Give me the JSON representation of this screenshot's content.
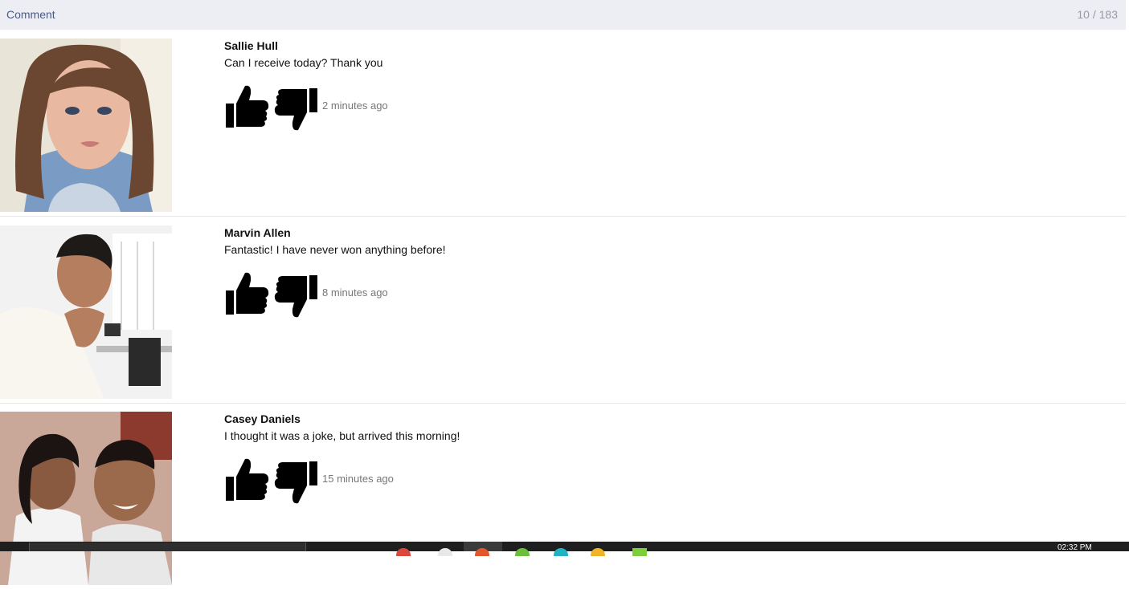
{
  "header": {
    "title": "Comment",
    "count": "10 / 183"
  },
  "comments": [
    {
      "name": "Sallie Hull",
      "text": "Can I receive today? Thank you",
      "time": "2 minutes ago"
    },
    {
      "name": "Marvin Allen",
      "text": "Fantastic! I have never won anything before!",
      "time": "8 minutes ago"
    },
    {
      "name": "Casey Daniels",
      "text": "I thought it was a joke, but arrived this morning!",
      "time": "15 minutes ago"
    }
  ],
  "icons": {
    "like": "thumbs-up-icon",
    "dislike": "thumbs-down-icon"
  },
  "taskbar": {
    "clock": "02:32 PM"
  },
  "colors": {
    "header_bg": "#eceef4",
    "header_title": "#4b5b8a",
    "count": "#9a9aa2",
    "time_text": "#777777"
  }
}
